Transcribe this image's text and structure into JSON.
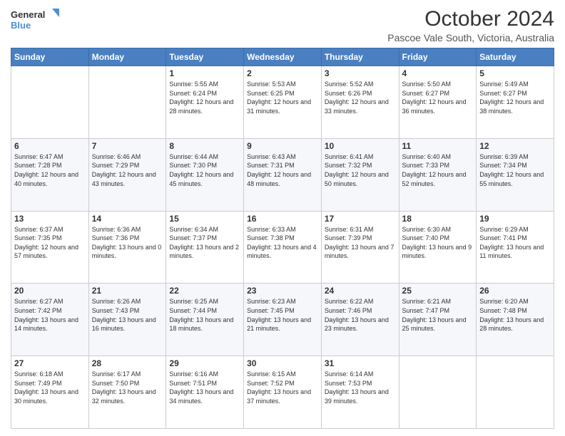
{
  "header": {
    "logo_line1": "General",
    "logo_line2": "Blue",
    "title": "October 2024",
    "subtitle": "Pascoe Vale South, Victoria, Australia"
  },
  "weekdays": [
    "Sunday",
    "Monday",
    "Tuesday",
    "Wednesday",
    "Thursday",
    "Friday",
    "Saturday"
  ],
  "weeks": [
    [
      {
        "day": "",
        "sunrise": "",
        "sunset": "",
        "daylight": ""
      },
      {
        "day": "",
        "sunrise": "",
        "sunset": "",
        "daylight": ""
      },
      {
        "day": "1",
        "sunrise": "Sunrise: 5:55 AM",
        "sunset": "Sunset: 6:24 PM",
        "daylight": "Daylight: 12 hours and 28 minutes."
      },
      {
        "day": "2",
        "sunrise": "Sunrise: 5:53 AM",
        "sunset": "Sunset: 6:25 PM",
        "daylight": "Daylight: 12 hours and 31 minutes."
      },
      {
        "day": "3",
        "sunrise": "Sunrise: 5:52 AM",
        "sunset": "Sunset: 6:26 PM",
        "daylight": "Daylight: 12 hours and 33 minutes."
      },
      {
        "day": "4",
        "sunrise": "Sunrise: 5:50 AM",
        "sunset": "Sunset: 6:27 PM",
        "daylight": "Daylight: 12 hours and 36 minutes."
      },
      {
        "day": "5",
        "sunrise": "Sunrise: 5:49 AM",
        "sunset": "Sunset: 6:27 PM",
        "daylight": "Daylight: 12 hours and 38 minutes."
      }
    ],
    [
      {
        "day": "6",
        "sunrise": "Sunrise: 6:47 AM",
        "sunset": "Sunset: 7:28 PM",
        "daylight": "Daylight: 12 hours and 40 minutes."
      },
      {
        "day": "7",
        "sunrise": "Sunrise: 6:46 AM",
        "sunset": "Sunset: 7:29 PM",
        "daylight": "Daylight: 12 hours and 43 minutes."
      },
      {
        "day": "8",
        "sunrise": "Sunrise: 6:44 AM",
        "sunset": "Sunset: 7:30 PM",
        "daylight": "Daylight: 12 hours and 45 minutes."
      },
      {
        "day": "9",
        "sunrise": "Sunrise: 6:43 AM",
        "sunset": "Sunset: 7:31 PM",
        "daylight": "Daylight: 12 hours and 48 minutes."
      },
      {
        "day": "10",
        "sunrise": "Sunrise: 6:41 AM",
        "sunset": "Sunset: 7:32 PM",
        "daylight": "Daylight: 12 hours and 50 minutes."
      },
      {
        "day": "11",
        "sunrise": "Sunrise: 6:40 AM",
        "sunset": "Sunset: 7:33 PM",
        "daylight": "Daylight: 12 hours and 52 minutes."
      },
      {
        "day": "12",
        "sunrise": "Sunrise: 6:39 AM",
        "sunset": "Sunset: 7:34 PM",
        "daylight": "Daylight: 12 hours and 55 minutes."
      }
    ],
    [
      {
        "day": "13",
        "sunrise": "Sunrise: 6:37 AM",
        "sunset": "Sunset: 7:35 PM",
        "daylight": "Daylight: 12 hours and 57 minutes."
      },
      {
        "day": "14",
        "sunrise": "Sunrise: 6:36 AM",
        "sunset": "Sunset: 7:36 PM",
        "daylight": "Daylight: 13 hours and 0 minutes."
      },
      {
        "day": "15",
        "sunrise": "Sunrise: 6:34 AM",
        "sunset": "Sunset: 7:37 PM",
        "daylight": "Daylight: 13 hours and 2 minutes."
      },
      {
        "day": "16",
        "sunrise": "Sunrise: 6:33 AM",
        "sunset": "Sunset: 7:38 PM",
        "daylight": "Daylight: 13 hours and 4 minutes."
      },
      {
        "day": "17",
        "sunrise": "Sunrise: 6:31 AM",
        "sunset": "Sunset: 7:39 PM",
        "daylight": "Daylight: 13 hours and 7 minutes."
      },
      {
        "day": "18",
        "sunrise": "Sunrise: 6:30 AM",
        "sunset": "Sunset: 7:40 PM",
        "daylight": "Daylight: 13 hours and 9 minutes."
      },
      {
        "day": "19",
        "sunrise": "Sunrise: 6:29 AM",
        "sunset": "Sunset: 7:41 PM",
        "daylight": "Daylight: 13 hours and 11 minutes."
      }
    ],
    [
      {
        "day": "20",
        "sunrise": "Sunrise: 6:27 AM",
        "sunset": "Sunset: 7:42 PM",
        "daylight": "Daylight: 13 hours and 14 minutes."
      },
      {
        "day": "21",
        "sunrise": "Sunrise: 6:26 AM",
        "sunset": "Sunset: 7:43 PM",
        "daylight": "Daylight: 13 hours and 16 minutes."
      },
      {
        "day": "22",
        "sunrise": "Sunrise: 6:25 AM",
        "sunset": "Sunset: 7:44 PM",
        "daylight": "Daylight: 13 hours and 18 minutes."
      },
      {
        "day": "23",
        "sunrise": "Sunrise: 6:23 AM",
        "sunset": "Sunset: 7:45 PM",
        "daylight": "Daylight: 13 hours and 21 minutes."
      },
      {
        "day": "24",
        "sunrise": "Sunrise: 6:22 AM",
        "sunset": "Sunset: 7:46 PM",
        "daylight": "Daylight: 13 hours and 23 minutes."
      },
      {
        "day": "25",
        "sunrise": "Sunrise: 6:21 AM",
        "sunset": "Sunset: 7:47 PM",
        "daylight": "Daylight: 13 hours and 25 minutes."
      },
      {
        "day": "26",
        "sunrise": "Sunrise: 6:20 AM",
        "sunset": "Sunset: 7:48 PM",
        "daylight": "Daylight: 13 hours and 28 minutes."
      }
    ],
    [
      {
        "day": "27",
        "sunrise": "Sunrise: 6:18 AM",
        "sunset": "Sunset: 7:49 PM",
        "daylight": "Daylight: 13 hours and 30 minutes."
      },
      {
        "day": "28",
        "sunrise": "Sunrise: 6:17 AM",
        "sunset": "Sunset: 7:50 PM",
        "daylight": "Daylight: 13 hours and 32 minutes."
      },
      {
        "day": "29",
        "sunrise": "Sunrise: 6:16 AM",
        "sunset": "Sunset: 7:51 PM",
        "daylight": "Daylight: 13 hours and 34 minutes."
      },
      {
        "day": "30",
        "sunrise": "Sunrise: 6:15 AM",
        "sunset": "Sunset: 7:52 PM",
        "daylight": "Daylight: 13 hours and 37 minutes."
      },
      {
        "day": "31",
        "sunrise": "Sunrise: 6:14 AM",
        "sunset": "Sunset: 7:53 PM",
        "daylight": "Daylight: 13 hours and 39 minutes."
      },
      {
        "day": "",
        "sunrise": "",
        "sunset": "",
        "daylight": ""
      },
      {
        "day": "",
        "sunrise": "",
        "sunset": "",
        "daylight": ""
      }
    ]
  ]
}
